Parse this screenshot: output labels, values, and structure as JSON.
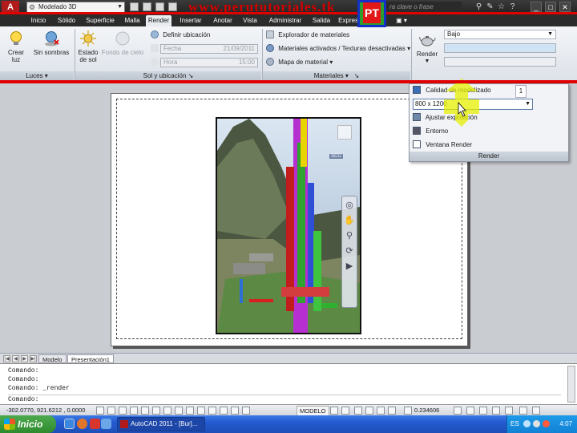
{
  "title_bar": {
    "workspace": "Modelado 3D",
    "watermark": "www.perututoriales.tk",
    "watermark_logo_text": "PT",
    "search_placeholder": "ra clave o frase"
  },
  "ribbon_tabs": [
    {
      "label": "Inicio"
    },
    {
      "label": "Sólido"
    },
    {
      "label": "Superficie"
    },
    {
      "label": "Malla"
    },
    {
      "label": "Render",
      "active": true
    },
    {
      "label": "Insertar"
    },
    {
      "label": "Anotar"
    },
    {
      "label": "Vista"
    },
    {
      "label": "Administrar"
    },
    {
      "label": "Salida"
    },
    {
      "label": "Express Tools"
    }
  ],
  "ribbon": {
    "luces": {
      "title": "Luces",
      "crear_luz": "Crear luz",
      "sin_sombras": "Sin sombras"
    },
    "sol": {
      "title": "Sol y ubicación",
      "estado_de_sol": "Estado de sol",
      "fondo_de_cielo": "Fondo de cielo",
      "definir_ubicacion": "Definir ubicación",
      "fecha_label": "Fecha",
      "fecha_value": "21/09/2011",
      "hora_label": "Hora",
      "hora_value": "15:00"
    },
    "materiales": {
      "title": "Materiales",
      "explorador": "Explorador de materiales",
      "activados": "Materiales activados / Texturas desactivadas",
      "mapa": "Mapa de material"
    },
    "render": {
      "render_label": "Render",
      "quality": "Bajo"
    }
  },
  "render_panel": {
    "calidad_label": "Calidad de modelizado",
    "calidad_value": "1",
    "resolution": "800 x 1200",
    "ajustar_exposicion": "Ajustar exposición",
    "entorno": "Entorno",
    "ventana_render": "Ventana Render",
    "title": "Render"
  },
  "viewport": {
    "scu_label": "SCU"
  },
  "layout_tabs": {
    "model": "Modelo",
    "layout1": "Presentación1"
  },
  "command_line": {
    "lines": [
      "Comando:",
      "Comando:",
      "Comando: _render"
    ],
    "prompt": "Comando:"
  },
  "status_bar": {
    "coords": "-302.0770, 921.6212 , 0.0000",
    "mode": "MODELO",
    "scale": "0.234606"
  },
  "taskbar": {
    "start_label": "Inicio",
    "autocad_task": "AutoCAD 2011 - [Bur]...",
    "language": "ES",
    "clock": "4:07"
  },
  "colors": {
    "ribbon_dark": "#2b2b2b",
    "accent_red": "#e00000",
    "highlight_yellow": "#e6f000",
    "taskbar_blue": "#245ad0"
  }
}
